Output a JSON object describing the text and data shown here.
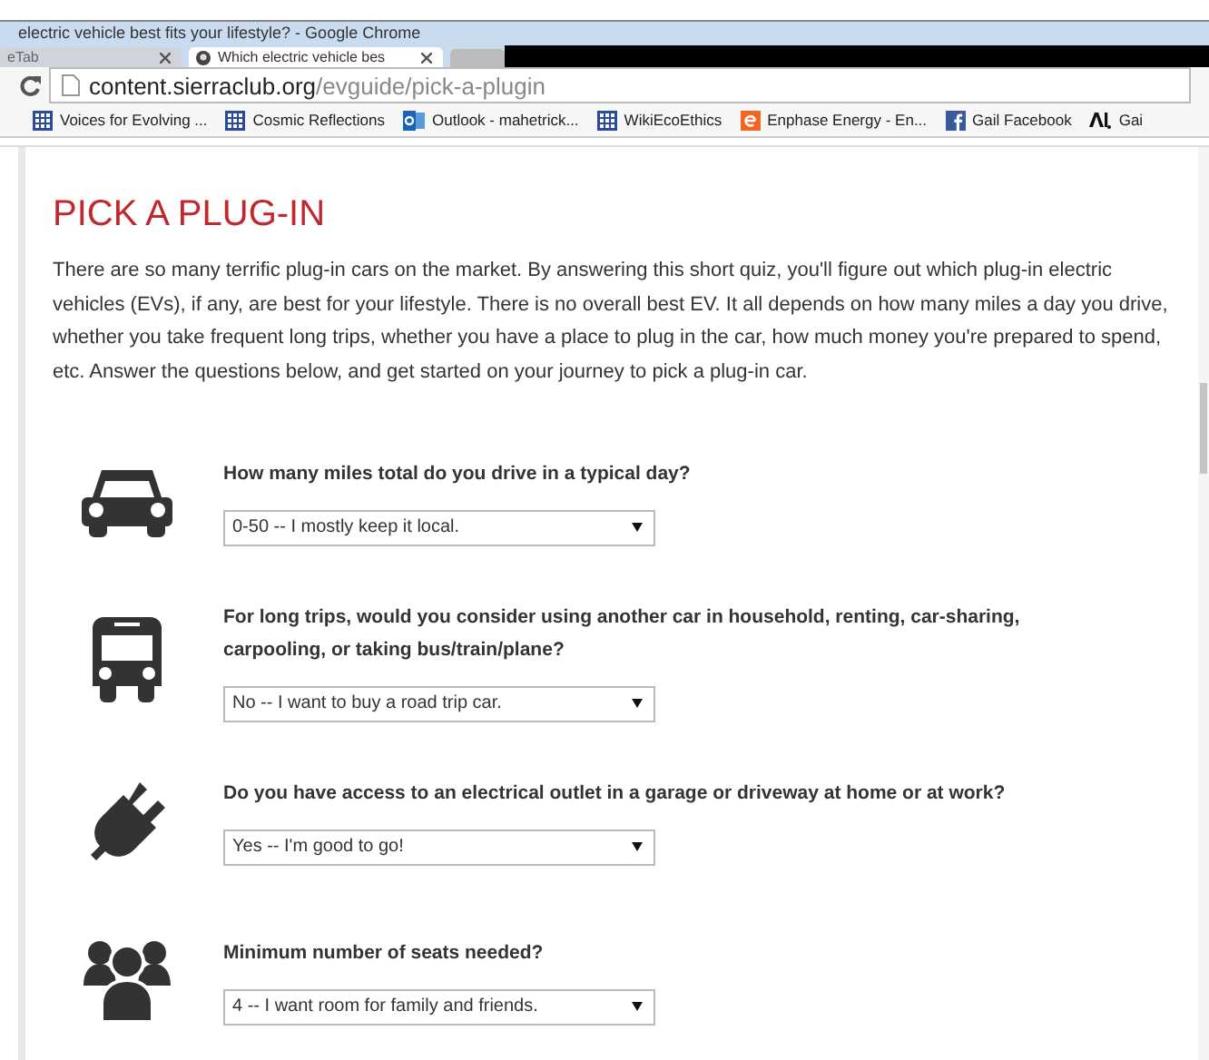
{
  "window": {
    "title": "electric vehicle best fits your lifestyle? - Google Chrome"
  },
  "tabs": [
    {
      "label": "eTab",
      "selected": false
    },
    {
      "label": "Which electric vehicle bes",
      "selected": true
    }
  ],
  "address": {
    "domain": "content.sierraclub.org",
    "path": "/evguide/pick-a-plugin"
  },
  "bookmarks": [
    {
      "kind": "grid",
      "label": "Voices for Evolving ..."
    },
    {
      "kind": "grid",
      "label": "Cosmic Reflections"
    },
    {
      "kind": "outlook",
      "label": "Outlook - mahetrick..."
    },
    {
      "kind": "grid",
      "label": "WikiEcoEthics"
    },
    {
      "kind": "enphase",
      "label": "Enphase Energy - En..."
    },
    {
      "kind": "facebook",
      "label": "Gail Facebook"
    },
    {
      "kind": "aol",
      "label": "Gai"
    }
  ],
  "page": {
    "title": "PICK A PLUG-IN",
    "intro": "There are so many terrific plug-in cars on the market. By answering this short quiz, you'll figure out which plug-in electric vehicles (EVs), if any, are best for your lifestyle. There is no overall best EV. It all depends on how many miles a day you drive, whether you take frequent long trips, whether you have a place to plug in the car, how much money you're prepared to spend, etc. Answer the questions below, and get started on your journey to pick a plug-in car."
  },
  "questions": [
    {
      "kind": "car",
      "question": "How many miles total do you drive in a typical day?",
      "answer": "0-50 -- I mostly keep it local."
    },
    {
      "kind": "bus",
      "question": "For long trips, would you consider using another car in household, renting, car-sharing, carpooling, or taking bus/train/plane?",
      "answer": "No -- I want to buy a road trip car."
    },
    {
      "kind": "plug",
      "question": "Do you have access to an electrical outlet in a garage or driveway at home or at work?",
      "answer": "Yes -- I'm good to go!"
    },
    {
      "kind": "people",
      "question": "Minimum number of seats needed?",
      "answer": "4 -- I want room for family and friends."
    }
  ]
}
